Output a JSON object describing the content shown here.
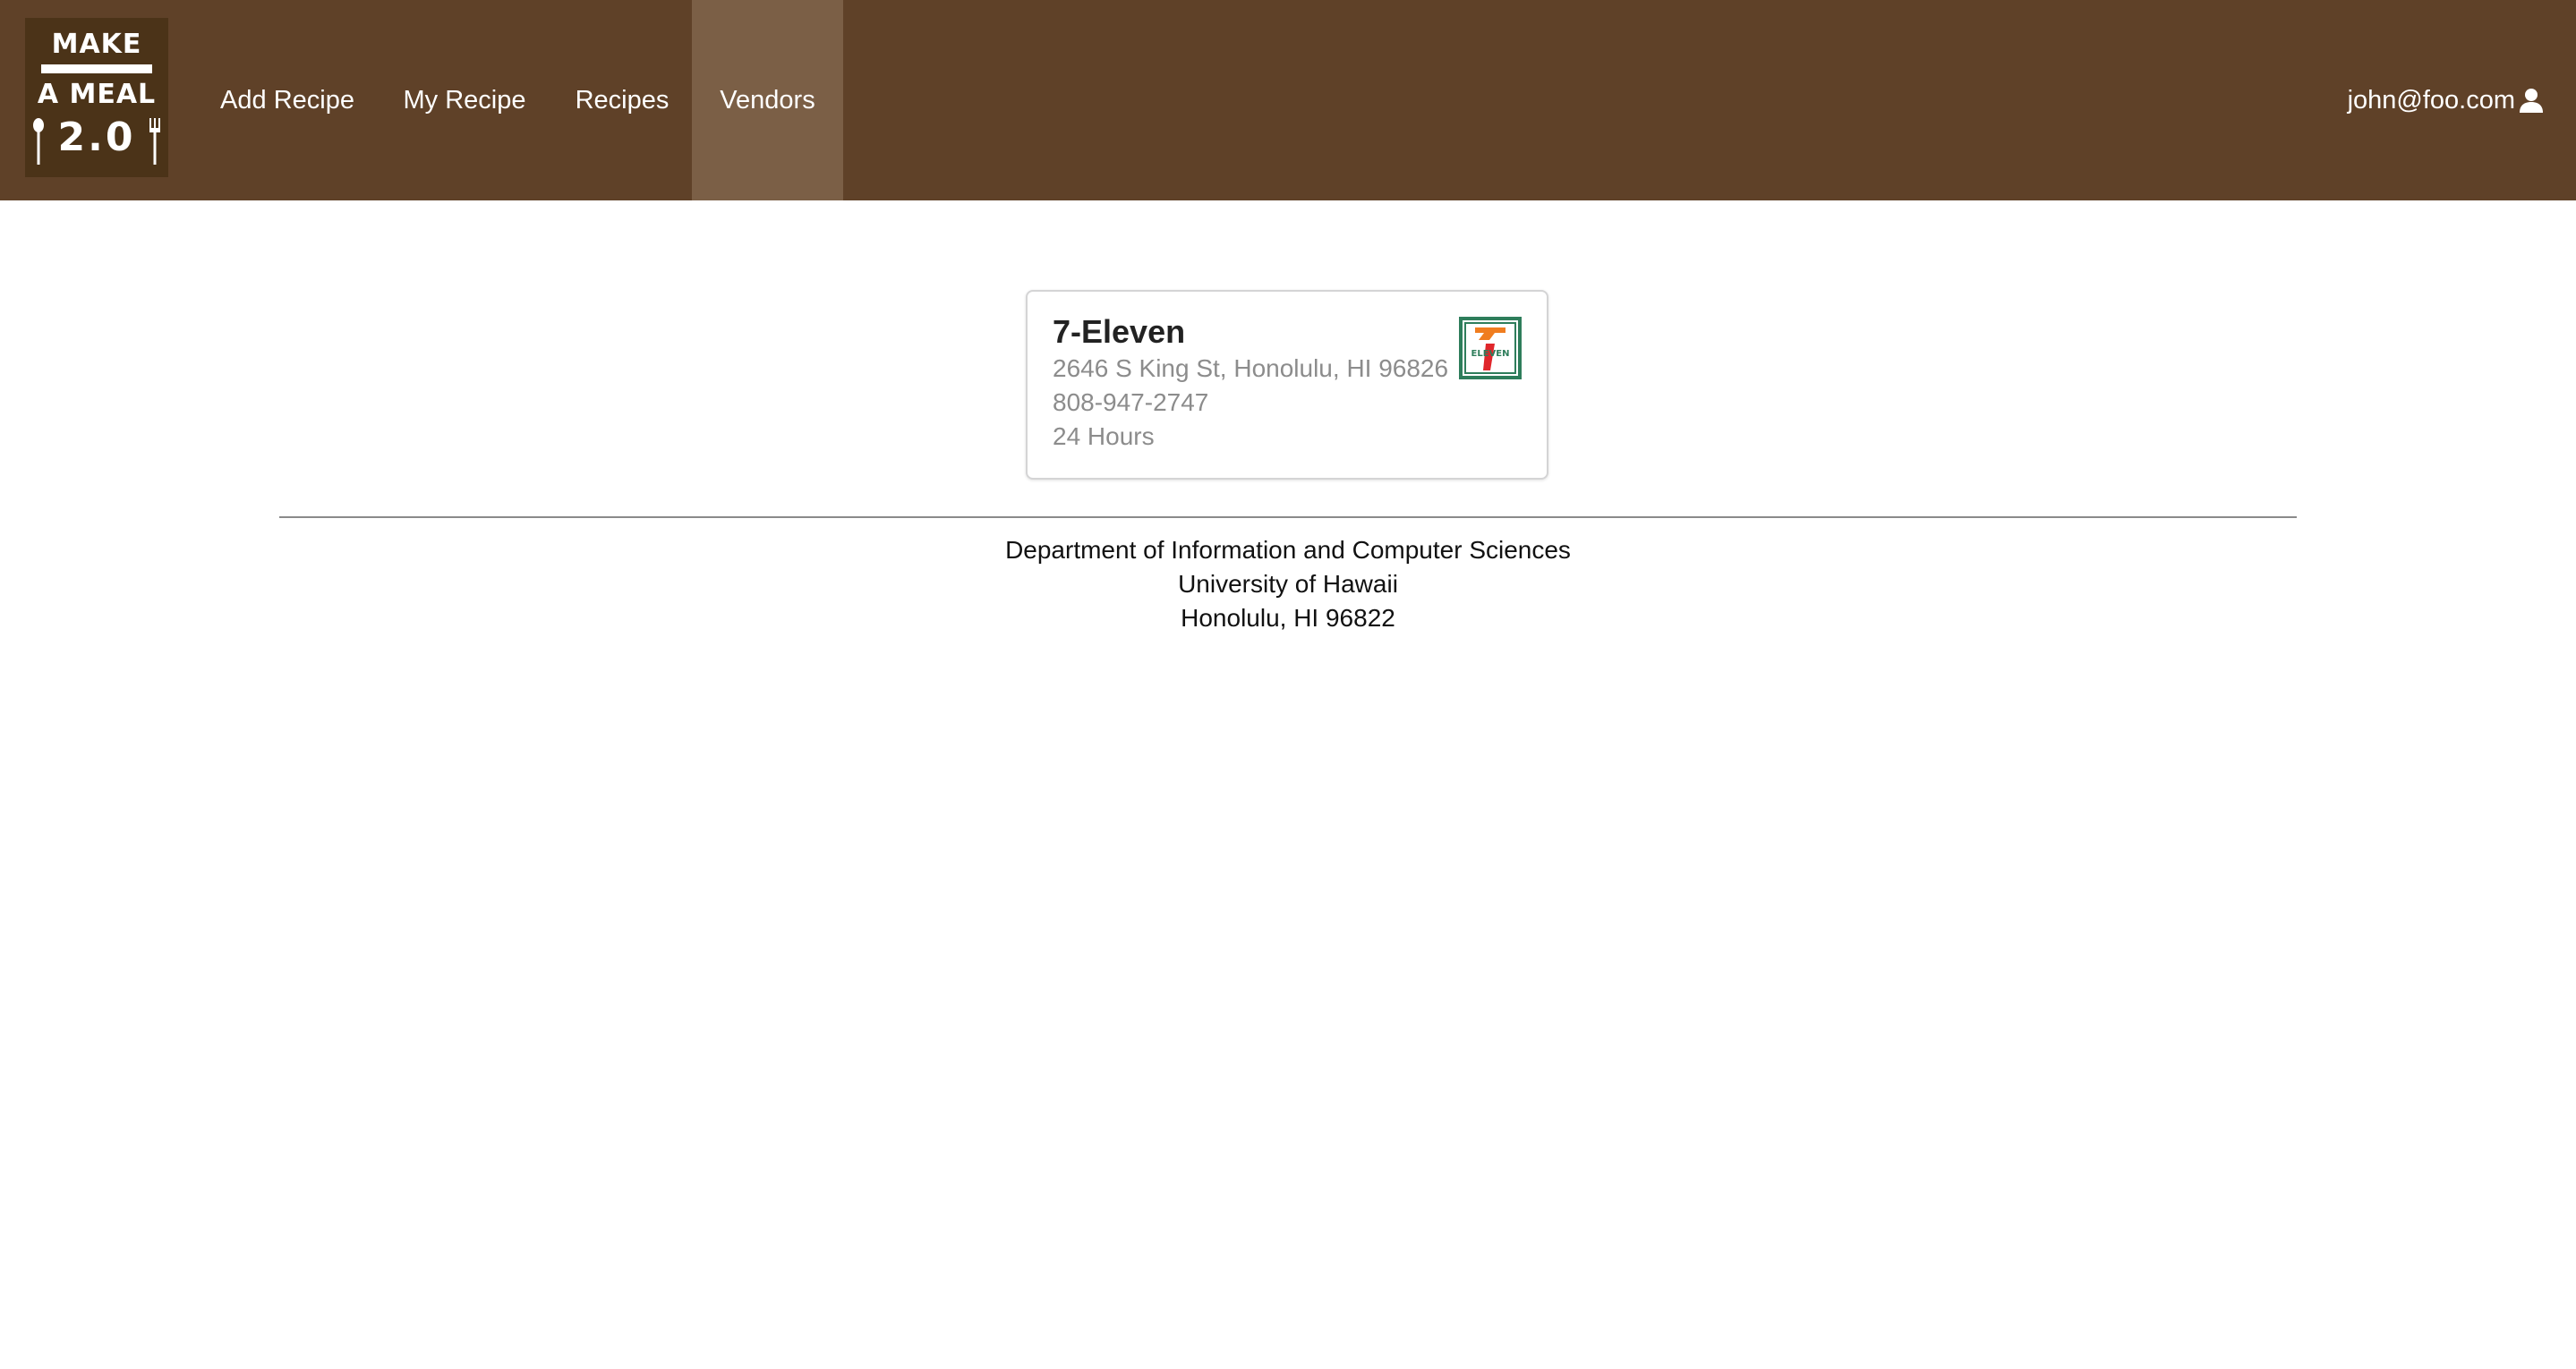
{
  "logo": {
    "line1": "MAKE",
    "line2": "A MEAL",
    "line3": "2.0"
  },
  "nav": {
    "items": [
      {
        "label": "Add Recipe",
        "active": false
      },
      {
        "label": "My Recipe",
        "active": false
      },
      {
        "label": "Recipes",
        "active": false
      },
      {
        "label": "Vendors",
        "active": true
      }
    ],
    "user": {
      "email": "john@foo.com",
      "icon": "user-icon"
    }
  },
  "vendor_card": {
    "name": "7-Eleven",
    "address": "2646 S King St, Honolulu, HI 96826",
    "phone": "808-947-2747",
    "hours": "24 Hours",
    "logo_text": "ELEVEN",
    "icon": "7-eleven-logo"
  },
  "footer": {
    "lines": [
      "Department of Information and Computer Sciences",
      "University of Hawaii",
      "Honolulu, HI 96822"
    ]
  },
  "colors": {
    "navbar": "#5f4128",
    "nav_active": "#7b5f46",
    "logo_bg": "#4b3318"
  }
}
